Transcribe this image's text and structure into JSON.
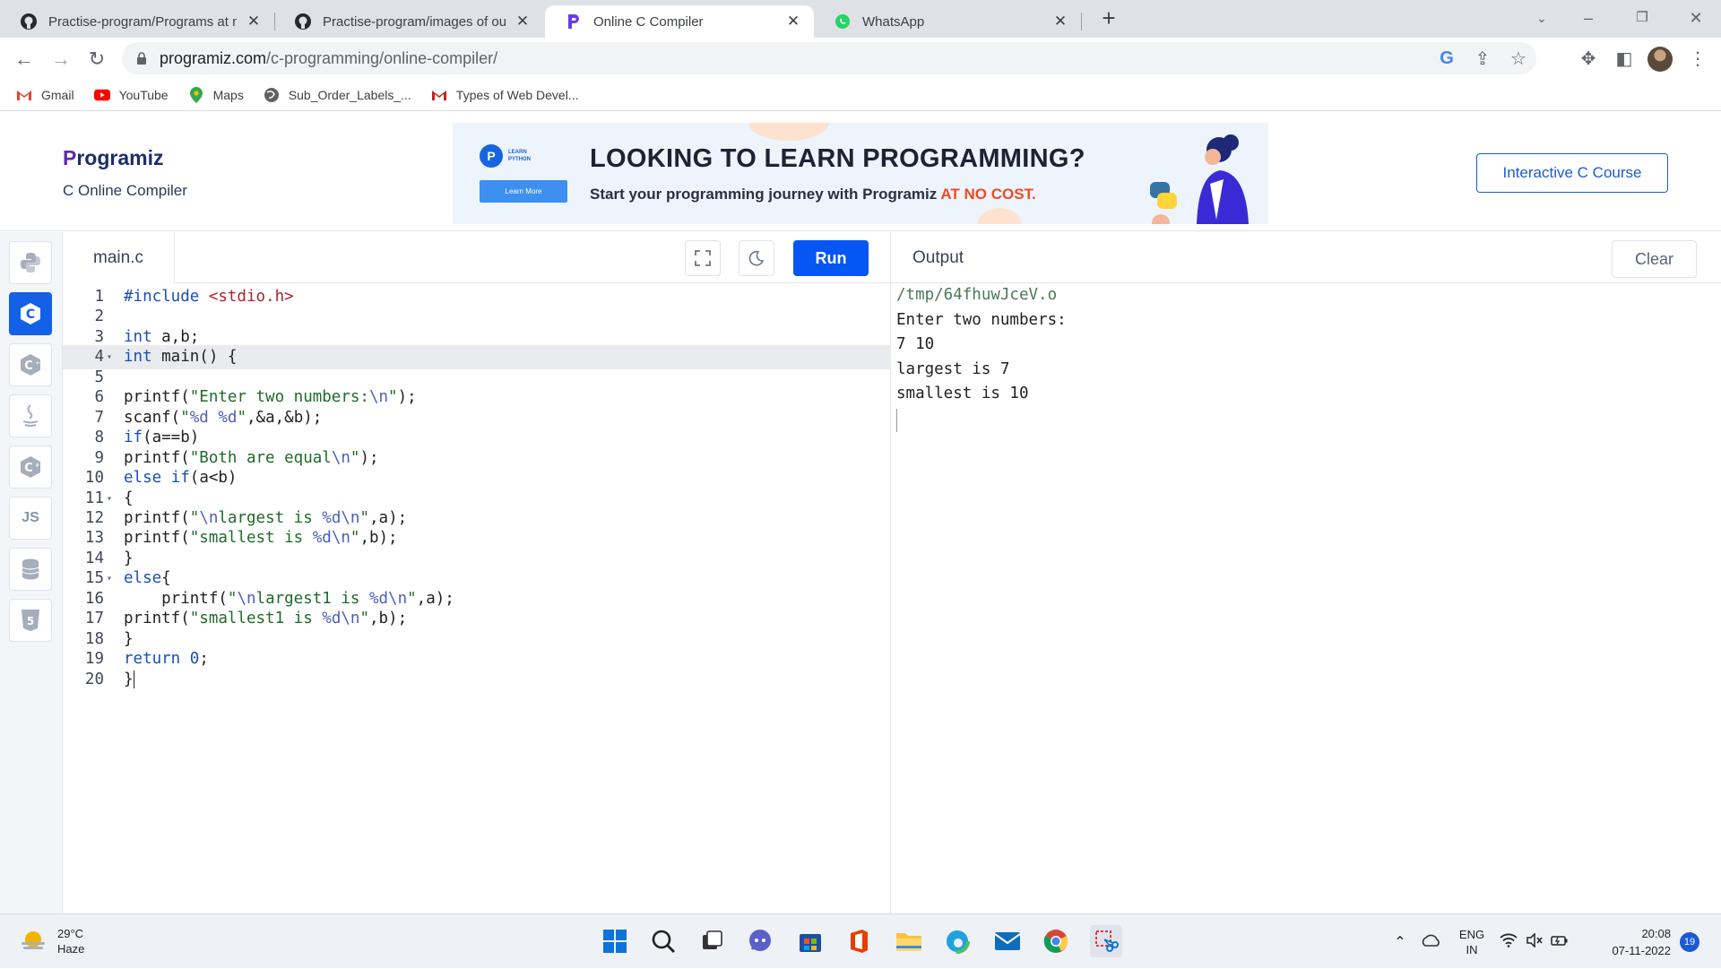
{
  "tabs": [
    {
      "title": "Practise-program/Programs at m",
      "icon": "github-icon"
    },
    {
      "title": "Practise-program/images of outp",
      "icon": "github-icon"
    },
    {
      "title": "Online C Compiler",
      "icon": "programiz-icon"
    },
    {
      "title": "WhatsApp",
      "icon": "whatsapp-icon"
    }
  ],
  "address": {
    "host": "programiz.com",
    "path": "/c-programming/online-compiler/"
  },
  "bookmarks": [
    "Gmail",
    "YouTube",
    "Maps",
    "Sub_Order_Labels_...",
    "Types of Web Devel..."
  ],
  "header": {
    "logo_first": "P",
    "logo_rest": "rogramiz",
    "subtitle": "C Online Compiler",
    "course_button": "Interactive C Course"
  },
  "banner": {
    "badge_line1": "LEARN",
    "badge_line2": "PYTHON",
    "learn_button": "Learn More",
    "headline": "LOOKING TO LEARN PROGRAMMING?",
    "tagline": "Start your programming journey with Programiz ",
    "tagline_accent": "AT NO COST."
  },
  "sidebar": {
    "languages": [
      "python-icon",
      "c-icon",
      "cpp-icon",
      "java-icon",
      "csharp-icon",
      "js-icon",
      "sql-icon",
      "html-icon"
    ],
    "js_label": "JS",
    "active": "c-icon"
  },
  "editor": {
    "filename": "main.c",
    "run_label": "Run",
    "highlighted_line": 4,
    "lines": [
      "#include <stdio.h>",
      "",
      "int a,b;",
      "int main() {",
      "",
      "printf(\"Enter two numbers:\\n\");",
      "scanf(\"%d %d\",&a,&b);",
      "if(a==b)",
      "printf(\"Both are equal\\n\");",
      "else if(a<b)",
      "{",
      "printf(\"\\nlargest is %d\\n\",a);",
      "printf(\"smallest is %d\\n\",b);",
      "}",
      "else{",
      "    printf(\"\\nlargest1 is %d\\n\",a);",
      "printf(\"smallest1 is %d\\n\",b);",
      "}",
      "return 0;",
      "}"
    ],
    "fold_lines": [
      4,
      11,
      15
    ]
  },
  "output": {
    "title": "Output",
    "clear_label": "Clear",
    "lines": [
      "/tmp/64fhuwJceV.o",
      "Enter two numbers:",
      "7 10",
      "largest is 7",
      "smallest is 10"
    ]
  },
  "taskbar": {
    "temperature": "29°C",
    "condition": "Haze",
    "language": "ENG",
    "region": "IN",
    "time": "20:08",
    "date": "07-11-2022",
    "notifications": "19"
  }
}
